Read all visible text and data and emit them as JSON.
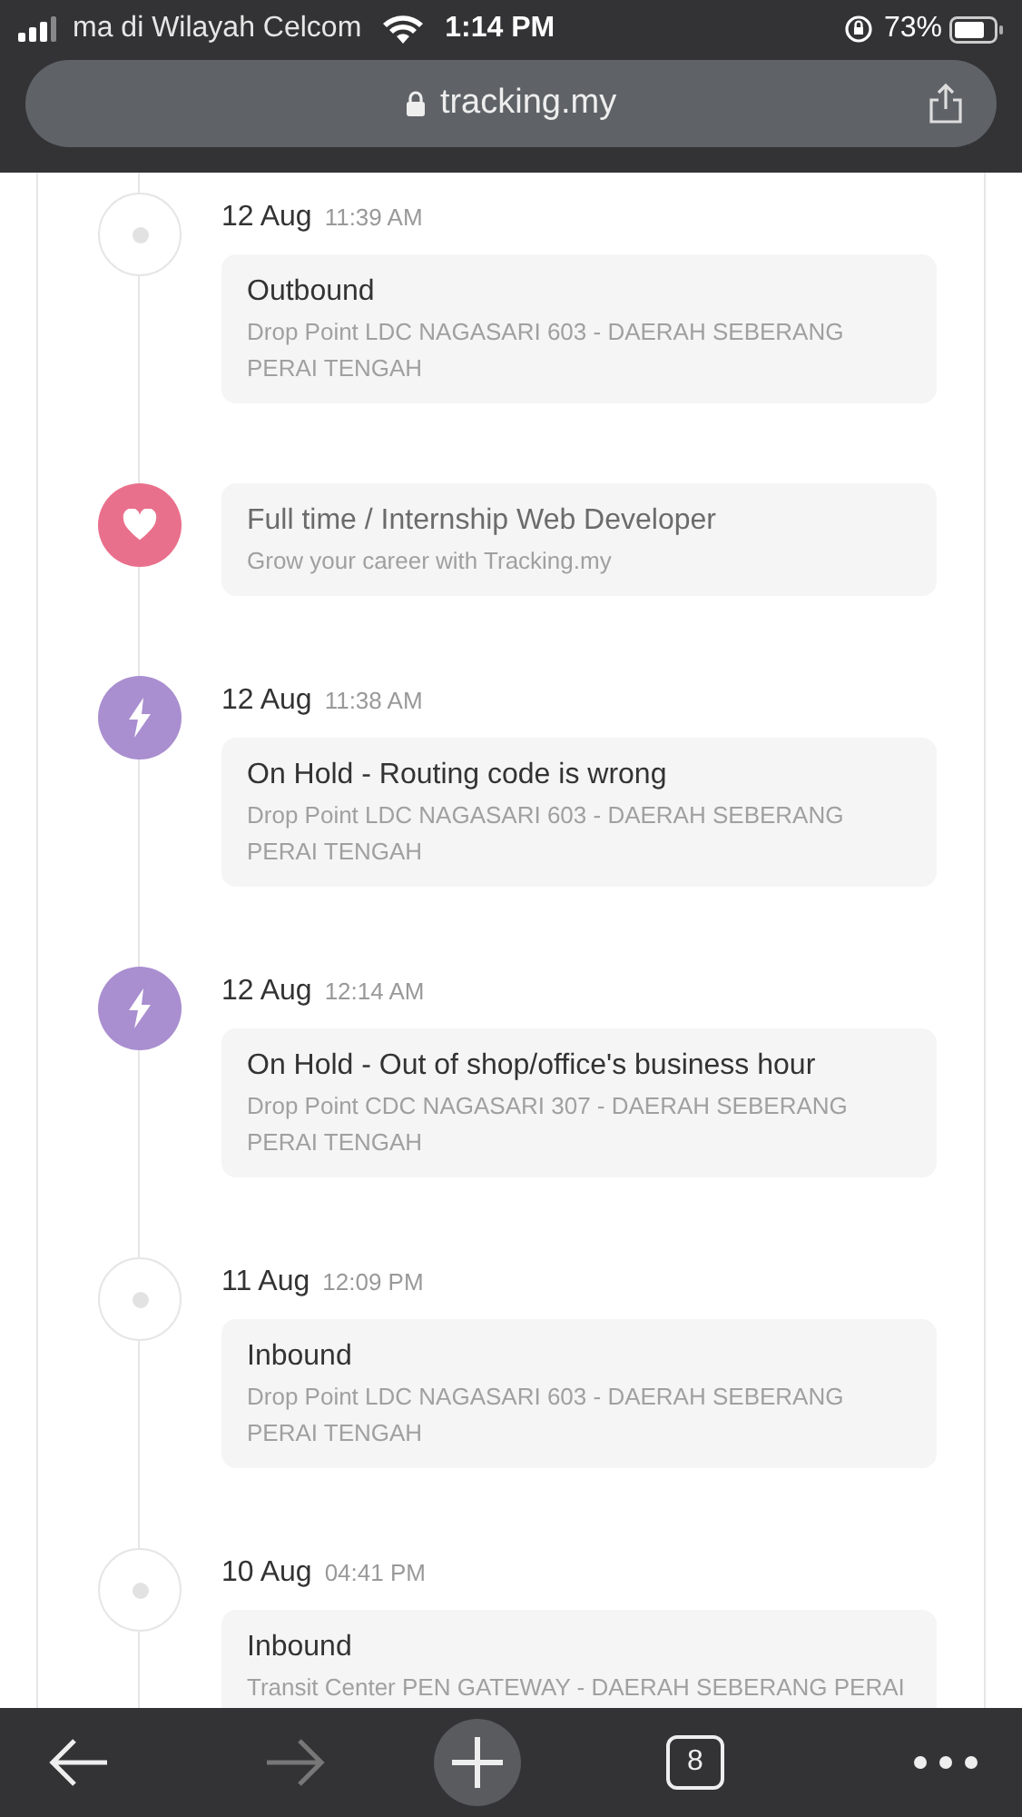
{
  "status_bar": {
    "carrier": "ma di Wilayah Celcom",
    "time": "1:14 PM",
    "battery": "73%"
  },
  "address_bar": {
    "url": "tracking.my"
  },
  "timeline": [
    {
      "kind": "event",
      "date": "12 Aug",
      "time": "11:39 AM",
      "title": "Outbound",
      "description": "Drop Point LDC NAGASARI 603 - DAERAH SEBERANG PERAI TENGAH"
    },
    {
      "kind": "ad",
      "title": "Full time / Internship Web Developer",
      "description": "Grow your career with Tracking.my"
    },
    {
      "kind": "hold",
      "date": "12 Aug",
      "time": "11:38 AM",
      "title": "On Hold - Routing code is wrong",
      "description": "Drop Point LDC NAGASARI 603 - DAERAH SEBERANG PERAI TENGAH"
    },
    {
      "kind": "hold",
      "date": "12 Aug",
      "time": "12:14 AM",
      "title": "On Hold - Out of shop/office's business hour",
      "description": "Drop Point CDC NAGASARI 307 - DAERAH SEBERANG PERAI TENGAH"
    },
    {
      "kind": "event",
      "date": "11 Aug",
      "time": "12:09 PM",
      "title": "Inbound",
      "description": "Drop Point LDC NAGASARI 603 - DAERAH SEBERANG PERAI TENGAH"
    },
    {
      "kind": "event",
      "date": "10 Aug",
      "time": "04:41 PM",
      "title": "Inbound",
      "description": "Transit Center PEN GATEWAY - DAERAH SEBERANG PERAI"
    }
  ],
  "toolbar": {
    "forward_disabled": true,
    "tab_count": "8"
  }
}
